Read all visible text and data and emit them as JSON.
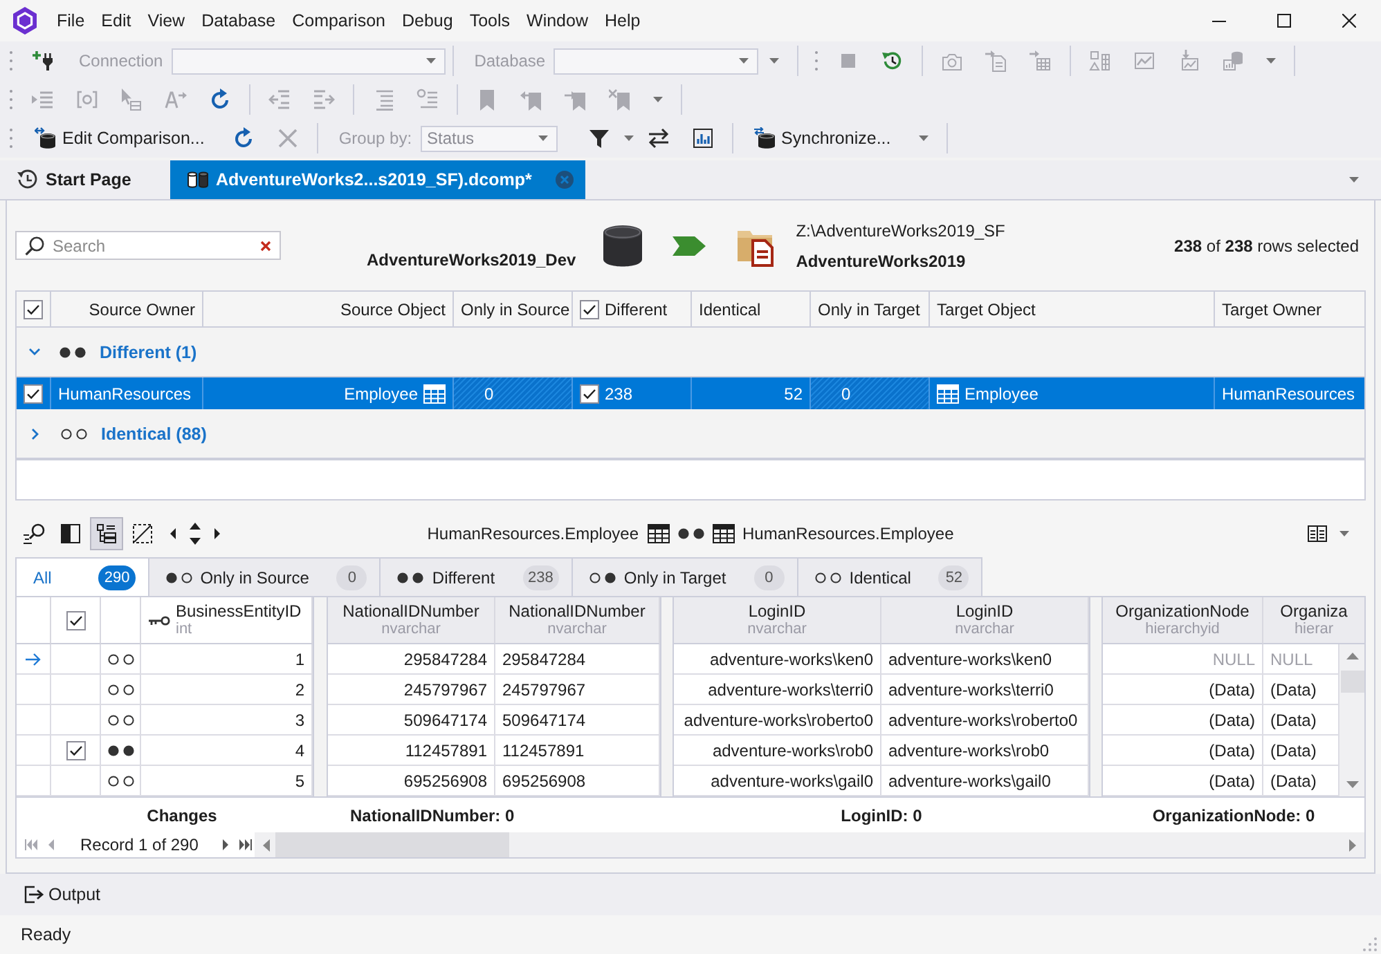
{
  "menu": [
    "File",
    "Edit",
    "View",
    "Database",
    "Comparison",
    "Debug",
    "Tools",
    "Window",
    "Help"
  ],
  "toolbar_1": {
    "tools": [
      {
        "disabled": false
      },
      {
        "disabled": true
      },
      {
        "disabled": false
      },
      {
        "disabled": true
      },
      {
        "disabled": true
      },
      {
        "disabled": true
      },
      {
        "disabled": true
      },
      {
        "disabled": true
      },
      {
        "disabled": true
      },
      {
        "disabled": true
      }
    ],
    "connection": {
      "label": "Connection",
      "disabled": true
    },
    "database": {
      "label": "Database",
      "disabled": true
    }
  },
  "toolbar_2": {
    "tools": [
      {
        "disabled": true
      },
      {
        "disabled": true
      },
      {
        "disabled": true
      },
      {
        "disabled": true
      },
      {
        "disabled": false
      },
      {
        "disabled": true
      },
      {
        "disabled": true
      },
      {
        "disabled": true
      },
      {
        "disabled": true
      },
      {
        "disabled": true
      },
      {
        "disabled": true
      },
      {
        "disabled": true
      },
      {
        "disabled": true
      }
    ]
  },
  "toolbar_3": {
    "edit_comparison": "Edit Comparison...",
    "tools": [
      {
        "disabled": false
      },
      {
        "disabled": true
      }
    ],
    "group_by": {
      "label": "Group by:",
      "value": "Status",
      "disabled": true
    },
    "view_tools": [
      {
        "disabled": false
      },
      {
        "disabled": false
      },
      {
        "disabled": false
      }
    ],
    "synchronize": "Synchronize..."
  },
  "tabs": [
    {
      "label": "Start Page",
      "kind": "start",
      "selected": false
    },
    {
      "label": "AdventureWorks2...s2019_SF).dcomp*",
      "kind": "comparison",
      "selected": true
    }
  ],
  "comparison": {
    "search": {
      "placeholder": "Search"
    },
    "source": {
      "name": "AdventureWorks2019_Dev"
    },
    "target": {
      "path": "Z:\\AdventureWorks2019_SF",
      "name": "AdventureWorks2019"
    },
    "selection": "**238** of **238** rows selected"
  },
  "objects": {
    "all_checked": true,
    "columns": [
      {
        "label": "Source Owner"
      },
      {
        "label": "Source Object"
      },
      {
        "label": "Only in Source"
      },
      {
        "label": "Different",
        "checked": true
      },
      {
        "label": "Identical"
      },
      {
        "label": "Only in Target"
      },
      {
        "label": "Target Object"
      },
      {
        "label": "Target Owner"
      }
    ],
    "groups": [
      {
        "label": "Different (1)",
        "dots": [
          true,
          true
        ],
        "expanded": true,
        "rows": [
          {
            "checked": true,
            "selected": true,
            "source_owner": "HumanResources",
            "source_object": "Employee",
            "only_in_source": "0",
            "different": "238",
            "different_checked": true,
            "identical": "52",
            "only_in_target": "0",
            "target_object": "Employee",
            "target_owner": "HumanResources"
          }
        ]
      },
      {
        "label": "Identical (88)",
        "dots": [
          false,
          false
        ],
        "expanded": false
      }
    ]
  },
  "detail": {
    "tools": [
      {
        "selected": false
      },
      {
        "selected": false
      },
      {
        "selected": true
      },
      {
        "selected": false
      }
    ],
    "source_table": "HumanResources.Employee",
    "target_table": "HumanResources.Employee",
    "dots": [
      true,
      true
    ],
    "filters": [
      {
        "label": "All",
        "count": "290",
        "selected": true
      },
      {
        "label": "Only in Source",
        "count": "0",
        "dots": [
          true,
          false
        ],
        "selected": false
      },
      {
        "label": "Different",
        "count": "238",
        "dots": [
          true,
          true
        ],
        "selected": false
      },
      {
        "label": "Only in Target",
        "count": "0",
        "dots": [
          false,
          true
        ],
        "selected": false
      },
      {
        "label": "Identical",
        "count": "52",
        "dots": [
          false,
          false
        ],
        "selected": false
      }
    ],
    "all_checked": true,
    "key_column": {
      "name": "BusinessEntityID",
      "type": "int"
    },
    "column_pairs": [
      {
        "source": {
          "name": "NationalIDNumber",
          "type": "nvarchar"
        },
        "target": {
          "name": "NationalIDNumber",
          "type": "nvarchar"
        }
      },
      {
        "source": {
          "name": "LoginID",
          "type": "nvarchar"
        },
        "target": {
          "name": "LoginID",
          "type": "nvarchar"
        }
      },
      {
        "source": {
          "name": "OrganizationNode",
          "type": "hierarchyid"
        },
        "target": {
          "name": "Organiza",
          "type": "hierar"
        }
      }
    ],
    "rows": [
      {
        "current": true,
        "dots": [
          false,
          false
        ],
        "id": "1",
        "values": [
          {
            "source": "295847284",
            "target": "295847284",
            "null": false
          },
          {
            "source": "adventure-works\\ken0",
            "target": "adventure-works\\ken0",
            "null": false
          },
          {
            "source": "NULL",
            "target": "NULL",
            "null": true
          }
        ]
      },
      {
        "current": false,
        "dots": [
          false,
          false
        ],
        "id": "2",
        "values": [
          {
            "source": "245797967",
            "target": "245797967",
            "null": false
          },
          {
            "source": "adventure-works\\terri0",
            "target": "adventure-works\\terri0",
            "null": false
          },
          {
            "source": "(Data)",
            "target": "(Data)",
            "null": false
          }
        ]
      },
      {
        "current": false,
        "dots": [
          false,
          false
        ],
        "id": "3",
        "values": [
          {
            "source": "509647174",
            "target": "509647174",
            "null": false
          },
          {
            "source": "adventure-works\\roberto0",
            "target": "adventure-works\\roberto0",
            "null": false
          },
          {
            "source": "(Data)",
            "target": "(Data)",
            "null": false
          }
        ]
      },
      {
        "current": false,
        "checked": true,
        "dots": [
          true,
          true
        ],
        "id": "4",
        "values": [
          {
            "source": "112457891",
            "target": "112457891",
            "null": false
          },
          {
            "source": "adventure-works\\rob0",
            "target": "adventure-works\\rob0",
            "null": false
          },
          {
            "source": "(Data)",
            "target": "(Data)",
            "null": false
          }
        ]
      },
      {
        "current": false,
        "dots": [
          false,
          false
        ],
        "id": "5",
        "values": [
          {
            "source": "695256908",
            "target": "695256908",
            "null": false
          },
          {
            "source": "adventure-works\\gail0",
            "target": "adventure-works\\gail0",
            "null": false
          },
          {
            "source": "(Data)",
            "target": "(Data)",
            "null": false
          }
        ]
      }
    ],
    "summary": {
      "label": "Changes",
      "counts": [
        "NationalIDNumber: 0",
        "LoginID: 0",
        "OrganizationNode: 0"
      ]
    },
    "nav": [
      {
        "disabled": true
      },
      {
        "disabled": true
      },
      {
        "disabled": false
      },
      {
        "disabled": false
      }
    ],
    "record": "Record 1 of 290"
  },
  "output": "Output",
  "status_bar": "Ready"
}
